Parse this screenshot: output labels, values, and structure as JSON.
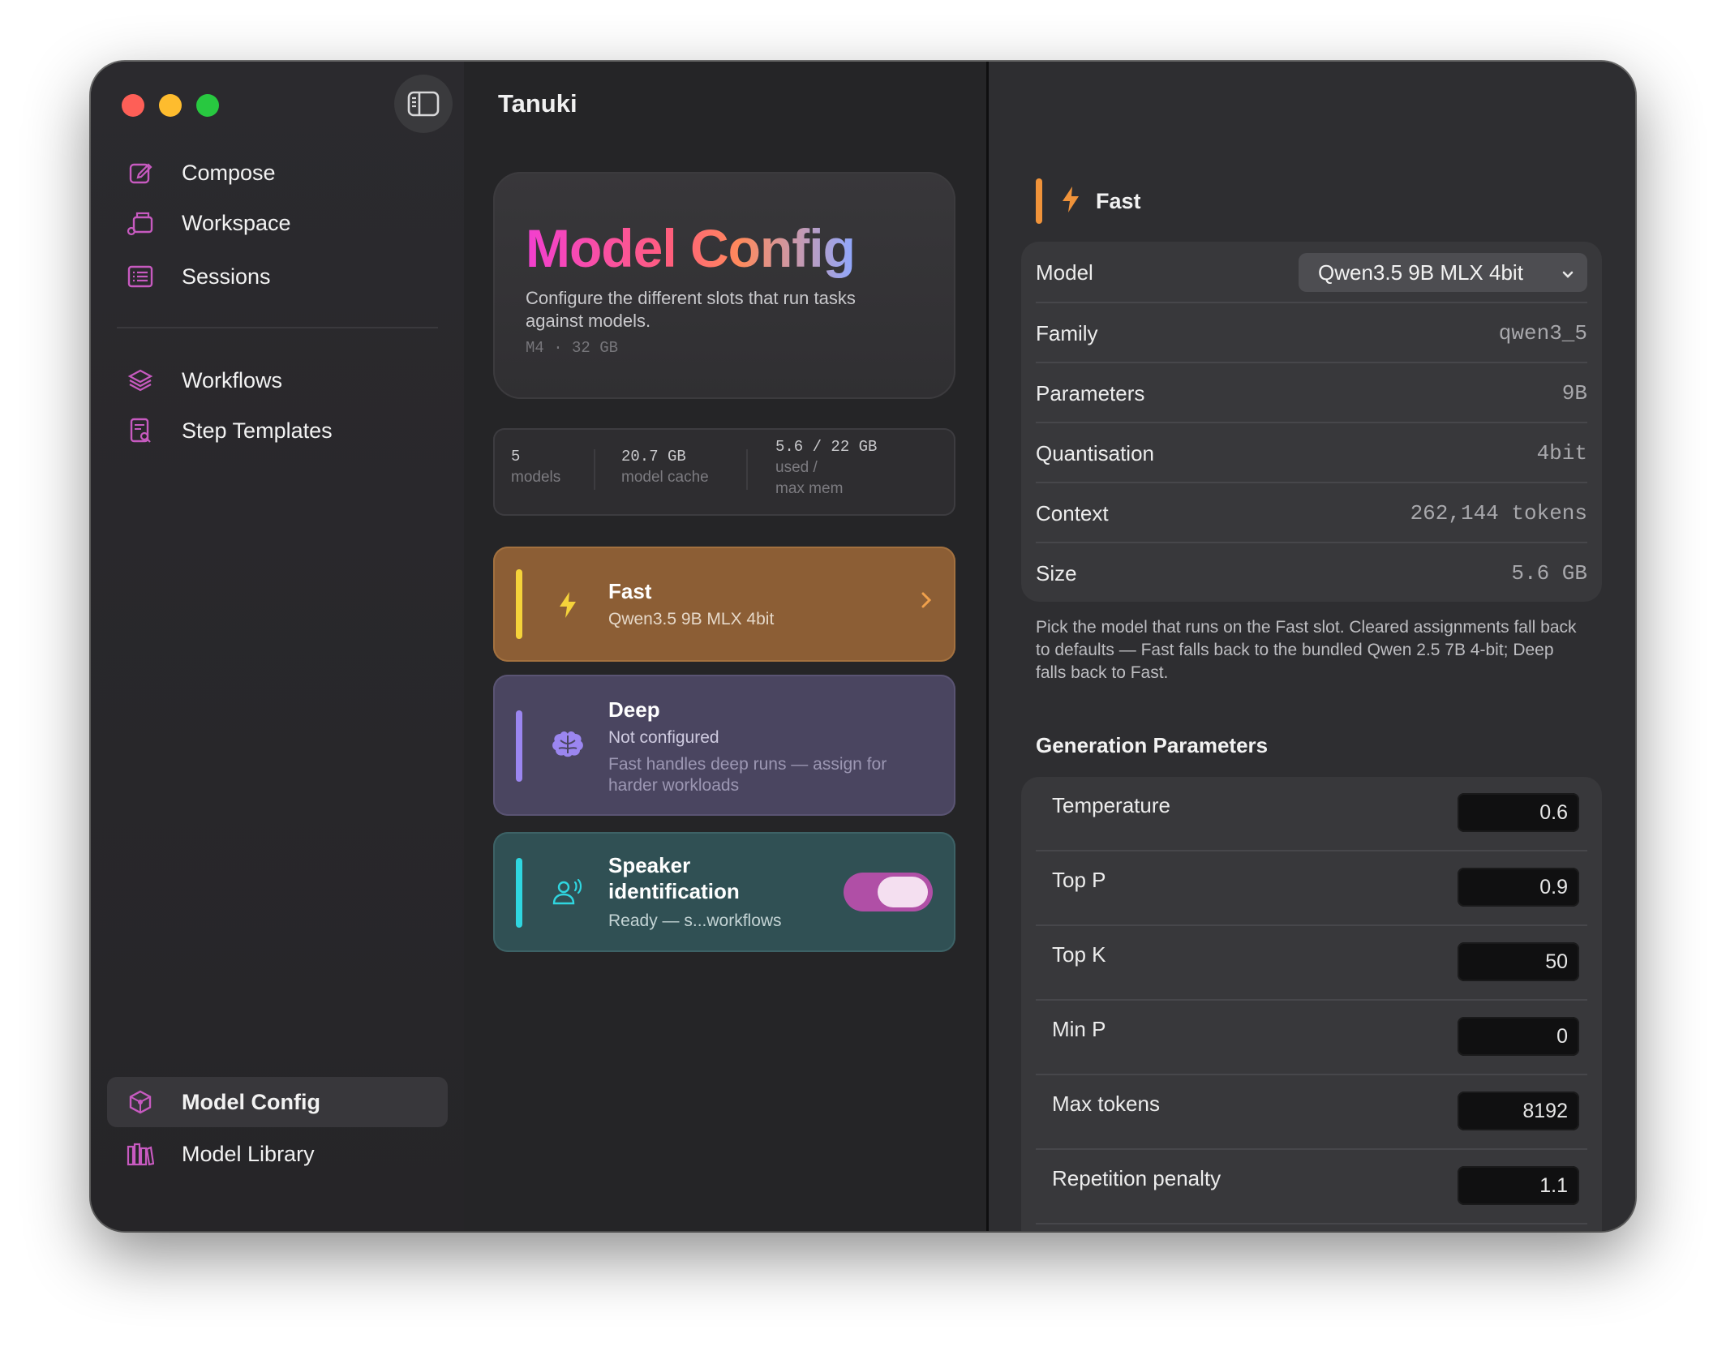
{
  "app": {
    "title": "Tanuki"
  },
  "sidebar": {
    "items": [
      {
        "label": "Compose",
        "icon": "compose-icon"
      },
      {
        "label": "Workspace",
        "icon": "workspace-icon"
      },
      {
        "label": "Sessions",
        "icon": "sessions-icon"
      },
      {
        "label": "Workflows",
        "icon": "workflows-icon"
      },
      {
        "label": "Step Templates",
        "icon": "step-templates-icon"
      }
    ],
    "bottom_items": [
      {
        "label": "Model Config",
        "icon": "model-config-icon",
        "active": true
      },
      {
        "label": "Model Library",
        "icon": "model-library-icon"
      }
    ]
  },
  "hero": {
    "title": "Model Config",
    "description": "Configure the different slots that run tasks against models.",
    "meta": "M4 · 32 GB"
  },
  "stats": {
    "models_value": "5",
    "models_label": "models",
    "cache_value": "20.7 GB",
    "cache_label": "model cache",
    "mem_value": "5.6 / 22 GB",
    "mem_label_1": "used /",
    "mem_label_2": "max mem"
  },
  "slots": {
    "fast": {
      "title": "Fast",
      "subtitle": "Qwen3.5 9B MLX 4bit",
      "icon": "lightning-icon",
      "color": "#f5d33a"
    },
    "deep": {
      "title": "Deep",
      "subtitle": "Not configured",
      "note": "Fast handles deep runs — assign for harder workloads",
      "icon": "brain-icon",
      "color": "#9b86f0"
    },
    "speaker": {
      "title_1": "Speaker",
      "title_2": "identification",
      "subtitle": "Ready — s...workflows",
      "icon": "speaker-id-icon",
      "color": "#2fd6e0",
      "enabled": true
    }
  },
  "detail": {
    "slot_title": "Fast",
    "model_label": "Model",
    "model_value": "Qwen3.5 9B MLX 4bit",
    "rows": [
      {
        "key": "Family",
        "value": "qwen3_5"
      },
      {
        "key": "Parameters",
        "value": "9B"
      },
      {
        "key": "Quantisation",
        "value": "4bit"
      },
      {
        "key": "Context",
        "value": "262,144 tokens"
      },
      {
        "key": "Size",
        "value": "5.6 GB"
      }
    ],
    "help": "Pick the model that runs on the Fast slot. Cleared assignments fall back to defaults — Fast falls back to the bundled Qwen 2.5 7B 4-bit; Deep falls back to Fast.",
    "gen_title": "Generation Parameters",
    "params": [
      {
        "key": "Temperature",
        "value": "0.6"
      },
      {
        "key": "Top P",
        "value": "0.9"
      },
      {
        "key": "Top K",
        "value": "50"
      },
      {
        "key": "Min P",
        "value": "0"
      },
      {
        "key": "Max tokens",
        "value": "8192"
      },
      {
        "key": "Repetition penalty",
        "value": "1.1"
      }
    ]
  },
  "colors": {
    "accent_fast": "#f0933a",
    "toggle_on": "#b04fa6"
  }
}
